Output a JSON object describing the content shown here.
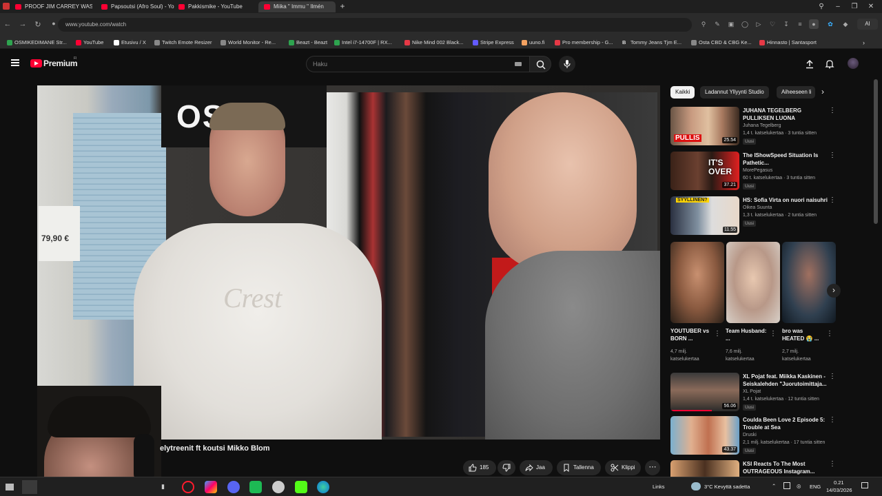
{
  "browser": {
    "tabs": [
      {
        "label": "PROOF JIM CARREY WAS",
        "fav": "#ff0033"
      },
      {
        "label": "Papsoutsi (Afro Soul) - Yo",
        "fav": "#ff0033"
      },
      {
        "label": "Pakkismike - YouTube",
        "fav": "#ff0033"
      },
      {
        "label": "Miika \" Immu \" Ilmén",
        "fav": "#ff0033"
      }
    ],
    "url": "www.youtube.com/watch",
    "bookmarks": [
      {
        "label": "OSMIKEDIMANE Str...",
        "color": "#2ea44f"
      },
      {
        "label": "YouTube",
        "color": "#ff0033"
      },
      {
        "label": "Etusivu / X",
        "color": "#ffffff"
      },
      {
        "label": "Twitch Emote Resizer",
        "color": "#888888"
      },
      {
        "label": "World Monitor - Re...",
        "color": "#888888"
      },
      {
        "label": "Beazt - Beazt",
        "color": "#2ea44f"
      },
      {
        "label": "Intel i7-14700F | RX...",
        "color": "#2ea44f"
      },
      {
        "label": "Nike Mind 002 Black...",
        "color": "#e63946"
      },
      {
        "label": "Stripe Express",
        "color": "#635bff"
      },
      {
        "label": "uuno.fi",
        "color": "#f4a261"
      },
      {
        "label": "Pro membership - G...",
        "color": "#e63946"
      },
      {
        "label": "Tommy Jeans Tjm E...",
        "color": "#dddddd"
      },
      {
        "label": "Osta CBD & CBG Ke...",
        "color": "#888888"
      },
      {
        "label": "Hinnasto | Santasport",
        "color": "#e63946"
      }
    ],
    "bookmark_letter_b": "B",
    "ai_label": "AI"
  },
  "youtube": {
    "logo_text": "Premium",
    "logo_sup": "FI",
    "search_placeholder": "Haku",
    "video_title": "elytreenit ft koutsi Mikko Blom",
    "actions": {
      "likes": "185",
      "share": "Jaa",
      "save": "Tallenna",
      "clip": "Klippi"
    },
    "video_overlay": {
      "sign_text": "OSEE",
      "price_text": "79,90 €",
      "hoodie_text": "Crest"
    },
    "chips": [
      {
        "label": "Kaikki",
        "selected": true
      },
      {
        "label": "Ladannut Yllyynti Studio",
        "selected": false
      },
      {
        "label": "Aiheeseen li",
        "selected": false
      }
    ],
    "recs": [
      {
        "title": "JUHANA TEGELBERG PULLIKSEN LUONA",
        "channel": "Juhana Tegelberg",
        "meta": "1,4 t. katselukertaa · 3 tuntia sitten",
        "badge": "Uusi",
        "duration": "25.54",
        "thumb_text": "PULLIS"
      },
      {
        "title": "The IShowSpeed Situation Is Pathetic...",
        "channel": "MorePegasus",
        "meta": "60 t. katselukertaa · 3 tuntia sitten",
        "badge": "Uusi",
        "duration": "37.21",
        "thumb_text": "IT'S OVER"
      },
      {
        "title": "HS: Sofia Virta on nuori naisuhri",
        "channel": "Oikea Suunta",
        "meta": "1,3 t. katselukertaa · 2 tuntia sitten",
        "badge": "Uusi",
        "duration": "11.55",
        "thumb_text": "SYYLLINEN?"
      },
      {
        "title": "XL Pojat feat. Miikka Kaskinen - Seiskalehden \"Juorutoimittaja...",
        "channel": "XL Pojat",
        "meta": "1,4 t. katselukertaa · 12 tuntia sitten",
        "badge": "Uusi",
        "duration": "56.06",
        "thumb_text": ""
      },
      {
        "title": "Coulda Been Love 2 Episode 5: Trouble at Sea",
        "channel": "Druski",
        "meta": "2,1 milj. katselukertaa · 17 tuntia sitten",
        "badge": "Uusi",
        "duration": "43.37",
        "thumb_text": ""
      },
      {
        "title": "KSI Reacts To The Most OUTRAGEOUS Instagram...",
        "channel": "",
        "meta": "",
        "badge": "",
        "duration": "",
        "thumb_text": ""
      }
    ],
    "shorts": [
      {
        "title": "YOUTUBER vs BORN ...",
        "views_a": "4,7 milj.",
        "views_b": "katselukertaa"
      },
      {
        "title": "Team Husband: ...",
        "views_a": "7,6 milj.",
        "views_b": "katselukertaa"
      },
      {
        "title": "bro was HEATED 😭 ...",
        "views_a": "2,7 milj.",
        "views_b": "katselukertaa"
      }
    ]
  },
  "taskbar": {
    "links": "Links",
    "weather": "3°C  Kevyttä sadetta",
    "lang": "ENG",
    "time": "0.21",
    "date": "14/03/2026"
  },
  "colors": {
    "yt_red": "#ff0033",
    "bg": "#0f0f0f"
  }
}
